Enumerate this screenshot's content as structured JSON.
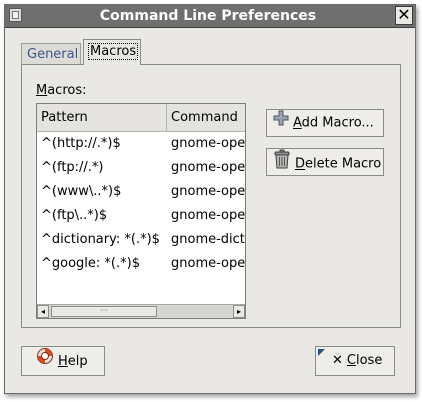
{
  "window": {
    "title": "Command Line Preferences",
    "close_glyph": "✕"
  },
  "tabs": [
    {
      "label": "General"
    },
    {
      "label": "Macros"
    }
  ],
  "macros_label": {
    "mnemonic": "M",
    "rest": "acros:"
  },
  "table": {
    "columns": [
      "Pattern",
      "Command"
    ],
    "rows": [
      {
        "pattern": "^(http://.*)$",
        "command": "gnome-ope"
      },
      {
        "pattern": "^(ftp://.*)",
        "command": "gnome-ope"
      },
      {
        "pattern": "^(www\\..*)$",
        "command": "gnome-ope"
      },
      {
        "pattern": "^(ftp\\..*)$",
        "command": "gnome-ope"
      },
      {
        "pattern": "^dictionary: *(.*)$",
        "command": "gnome-dict"
      },
      {
        "pattern": "^google: *(.*)$",
        "command": "gnome-ope"
      }
    ],
    "scroll_left_glyph": "◂",
    "scroll_right_glyph": "▸",
    "scroll_thumb_grip": "···"
  },
  "buttons": {
    "add_macro": {
      "mnemonic": "A",
      "rest": "dd Macro...",
      "icon": "plus-icon"
    },
    "delete_macro": {
      "mnemonic": "D",
      "rest": "elete Macro",
      "icon": "trash-icon"
    },
    "help": {
      "mnemonic": "H",
      "rest": "elp",
      "icon": "lifebuoy-icon"
    },
    "close": {
      "glyph": "✕",
      "mnemonic": "C",
      "rest": "lose",
      "icon": "close-icon"
    }
  },
  "colors": {
    "titlebar": "#6f6f6f",
    "window_bg": "#e9e8e4",
    "accent": "#2b4e86"
  }
}
